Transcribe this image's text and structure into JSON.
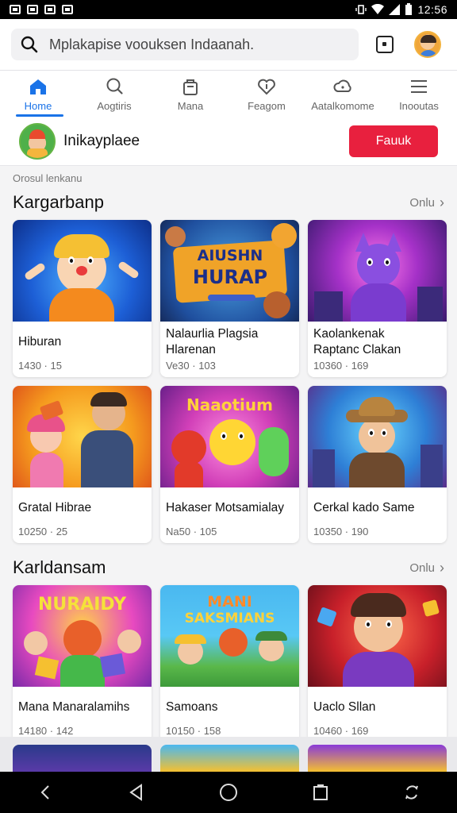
{
  "status_bar": {
    "time": "12:56"
  },
  "search": {
    "placeholder": "Mplakapise voouksen Indaanah."
  },
  "nav": {
    "items": [
      {
        "label": "Home",
        "icon": "home-icon"
      },
      {
        "label": "Aogtiris",
        "icon": "search-icon"
      },
      {
        "label": "Mana",
        "icon": "bag-icon"
      },
      {
        "label": "Feagom",
        "icon": "heart-icon"
      },
      {
        "label": "Aatalkomome",
        "icon": "cloud-icon"
      },
      {
        "label": "Inooutas",
        "icon": "menu-icon"
      }
    ]
  },
  "profile": {
    "name": "Inikayplaee",
    "button_label": "Fauuk"
  },
  "subtext": "Orosul lenkanu",
  "sections": [
    {
      "title": "Kargarbanp",
      "see_all": "Onlu",
      "cards": [
        {
          "title_line1": "Hiburan",
          "title_line2": "",
          "meta": "1430 · 15"
        },
        {
          "title_line1": "Nalaurlia Plagsia",
          "title_line2": "Hlarenan",
          "meta": "Ve30 · 103"
        },
        {
          "title_line1": "Kaolankenak",
          "title_line2": "Raptanc Clakan",
          "meta": "10360 · 169"
        },
        {
          "title_line1": "Gratal Hibrae",
          "title_line2": "",
          "meta": "10250 · 25"
        },
        {
          "title_line1": "Hakaser Motsamialay",
          "title_line2": "",
          "meta": "Na50 · 105"
        },
        {
          "title_line1": "Cerkal kado Same",
          "title_line2": "",
          "meta": "10350 · 190"
        }
      ]
    },
    {
      "title": "Karldansam",
      "see_all": "Onlu",
      "cards": [
        {
          "title_line1": "Mana Manaralamihs",
          "title_line2": "",
          "meta": "14180 · 142"
        },
        {
          "title_line1": "Samoans",
          "title_line2": "",
          "meta": "10150 · 158"
        },
        {
          "title_line1": "Uaclo Sllan",
          "title_line2": "",
          "meta": "10460 · 169"
        }
      ]
    }
  ],
  "art": {
    "hiburan_thumb": "HURAP",
    "card2_art_line1": "AIUSHN",
    "card2_art_line2": "HURAP",
    "card5_art": "Naaotium",
    "card7_art": "NURAIDY",
    "card8_art_line1": "MANI",
    "card8_art_line2": "SAKSMIANS"
  },
  "colors": {
    "accent": "#1a73e8",
    "primary_button": "#e8203e"
  }
}
